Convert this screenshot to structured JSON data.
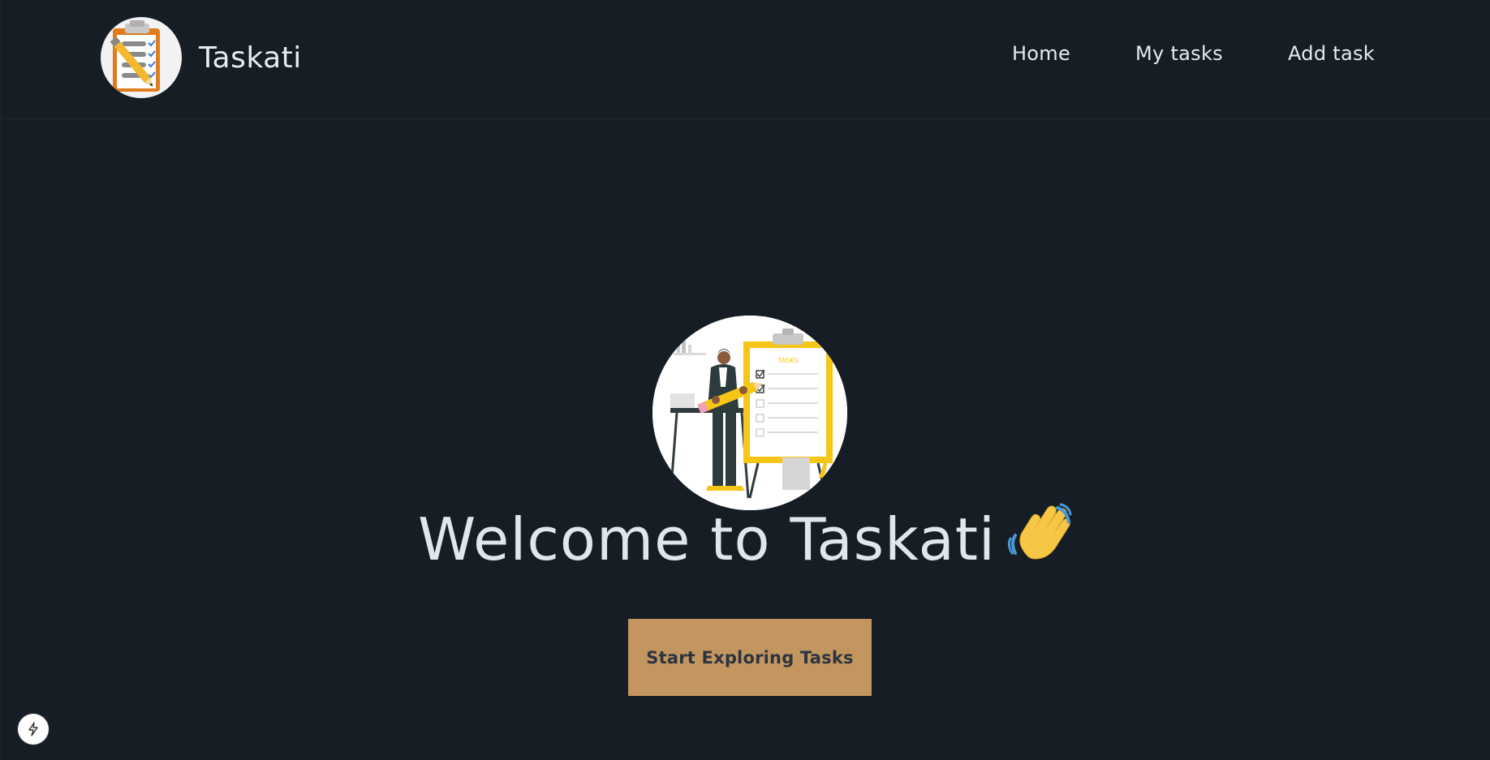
{
  "brand": {
    "name": "Taskati",
    "logo_icon": "clipboard-checklist-icon"
  },
  "nav": {
    "items": [
      {
        "label": "Home"
      },
      {
        "label": "My tasks"
      },
      {
        "label": "Add task"
      }
    ]
  },
  "hero": {
    "illustration": "person-with-pencil-and-task-board-illustration",
    "illustration_text": "TASKS",
    "title": "Welcome to Taskati",
    "title_icon": "waving-hand-icon",
    "cta_label": "Start Exploring Tasks"
  },
  "floating": {
    "icon": "lightning-bolt-icon"
  },
  "colors": {
    "background": "#161d25",
    "text": "#e6ebf0",
    "cta_bg": "#c4965f",
    "cta_text": "#2b3440",
    "accent_yellow": "#f5c518"
  }
}
